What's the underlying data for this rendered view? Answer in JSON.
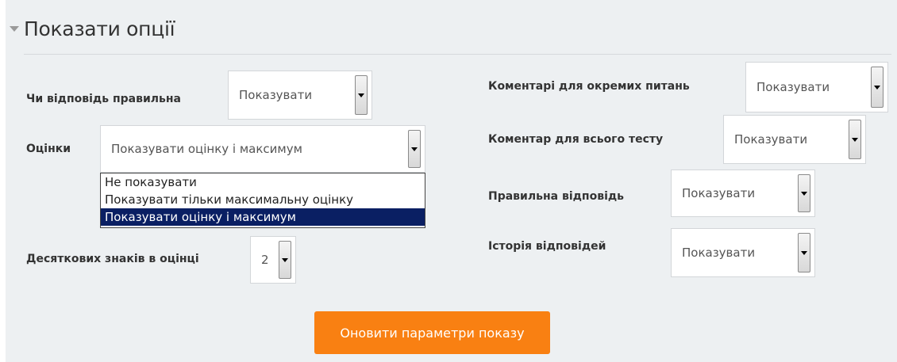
{
  "section": {
    "title": "Показати опції"
  },
  "left": {
    "correct": {
      "label": "Чи відповідь правильна",
      "value": "Показувати"
    },
    "marks": {
      "label": "Оцінки",
      "value": "Показувати оцінку і максимум",
      "options": [
        "Не показувати",
        "Показувати тільки максимальну оцінку",
        "Показувати оцінку і максимум"
      ],
      "selected_index": 2
    },
    "decimals": {
      "label": "Десяткових знаків в оцінці",
      "value": "2"
    }
  },
  "right": {
    "specific_feedback": {
      "label": "Коментарі для окремих питань",
      "value": "Показувати"
    },
    "general_feedback": {
      "label": "Коментар для всього тесту",
      "value": "Показувати"
    },
    "right_answer": {
      "label": "Правильна відповідь",
      "value": "Показувати"
    },
    "history": {
      "label": "Історія відповідей",
      "value": "Показувати"
    }
  },
  "actions": {
    "update_label": "Оновити параметри показу"
  },
  "colors": {
    "panel_bg": "#edf0f2",
    "primary_button": "#f98012",
    "selected_option": "#0a1f63"
  },
  "icons": {
    "legend_toggle": "collapse-triangle-icon",
    "select_arrow": "chevron-down-icon"
  }
}
